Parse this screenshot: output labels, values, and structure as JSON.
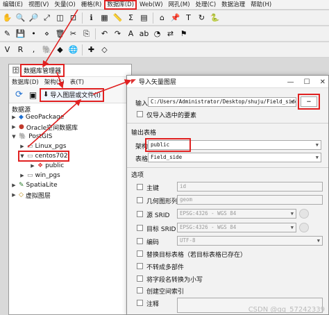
{
  "menubar": [
    "编辑(E)",
    "视图(V)",
    "矢量(O)",
    "栅格(R)",
    "数据库(D)",
    "Web(W)",
    "网孔(M)",
    "处理(C)",
    "数据治理",
    "帮助(H)"
  ],
  "db_manager": {
    "title": "数据库管理器",
    "menu": [
      "数据库(D)",
      "架构(S)",
      "表(T)"
    ],
    "import_button": "导入图层或文件(I)",
    "source_label": "数据源",
    "tree": {
      "geopackage": "GeoPackage",
      "oracle": "Oracle空间数据库",
      "postgis": "PostGIS",
      "linux_pgs": "Linux_pgs",
      "centos702": "centos702",
      "public": "public",
      "win_pgs": "win_pgs",
      "spatialite": "SpatiaLite",
      "virtual": "虚拟图层"
    }
  },
  "import_dialog": {
    "title": "导入矢量图层",
    "window_buttons": {
      "minimize": "—",
      "maximize": "☐",
      "close": "✕"
    },
    "input_label": "输入",
    "input_value": "C:/Users/Administrator/Desktop/shuju/Field_side.shp",
    "browse_label": "…",
    "only_selected": "仅导入选中的要素",
    "output_section": "输出表格",
    "schema_label": "架构",
    "schema_value": "public",
    "table_label": "表格",
    "table_value": "Field_side",
    "options_section": "选项",
    "options": {
      "primary_key": {
        "label": "主键",
        "value": "id"
      },
      "geometry_column": {
        "label": "几何图形列",
        "value": "geom"
      },
      "source_srid": {
        "label": "源 SRID",
        "value": "EPSG:4326 - WGS 84"
      },
      "target_srid": {
        "label": "目标 SRID",
        "value": "EPSG:4326 - WGS 84"
      },
      "encoding": {
        "label": "编码",
        "value": "UTF-8"
      },
      "replace_table": "替换目标表格（若目标表格已存在）",
      "no_multipart": "不转成多部件",
      "lowercase": "将字段名转换为小写",
      "spatial_index": "创建空间索引",
      "comment": "注释"
    }
  },
  "watermark": "CSDN @qq_57242339",
  "colors": {
    "highlight_red": "#e02020",
    "accent_blue": "#1e6fd0"
  }
}
